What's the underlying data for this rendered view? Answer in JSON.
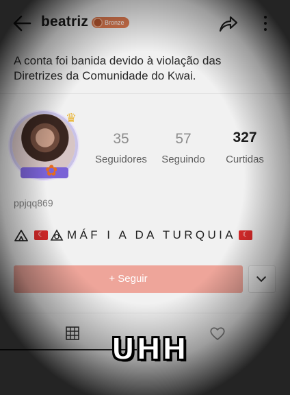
{
  "header": {
    "title": "beatriz",
    "badge": "Bronze",
    "back_icon": "arrow-left-icon",
    "share_icon": "share-icon",
    "more_icon": "more-vertical-icon"
  },
  "banned_notice": "A conta foi banida devido à violação das Diretrizes da Comunidade do Kwai.",
  "stats": [
    {
      "value": "35",
      "label": "Seguidores"
    },
    {
      "value": "57",
      "label": "Seguindo"
    },
    {
      "value": "327",
      "label": "Curtidas"
    }
  ],
  "username": "ppjqq869",
  "bio": {
    "text": "MÁF I A DA TURQUIA",
    "icons": [
      "tent-icon",
      "turkey-flag-icon",
      "emblem-icon",
      "turkey-flag-icon"
    ]
  },
  "follow_button": "+ Seguir",
  "tabs": [
    "grid-icon",
    "heart-icon"
  ],
  "caption": "UHH",
  "colors": {
    "accent": "#eea59a",
    "badge": "#d9774e",
    "flag": "#d92b2b"
  }
}
